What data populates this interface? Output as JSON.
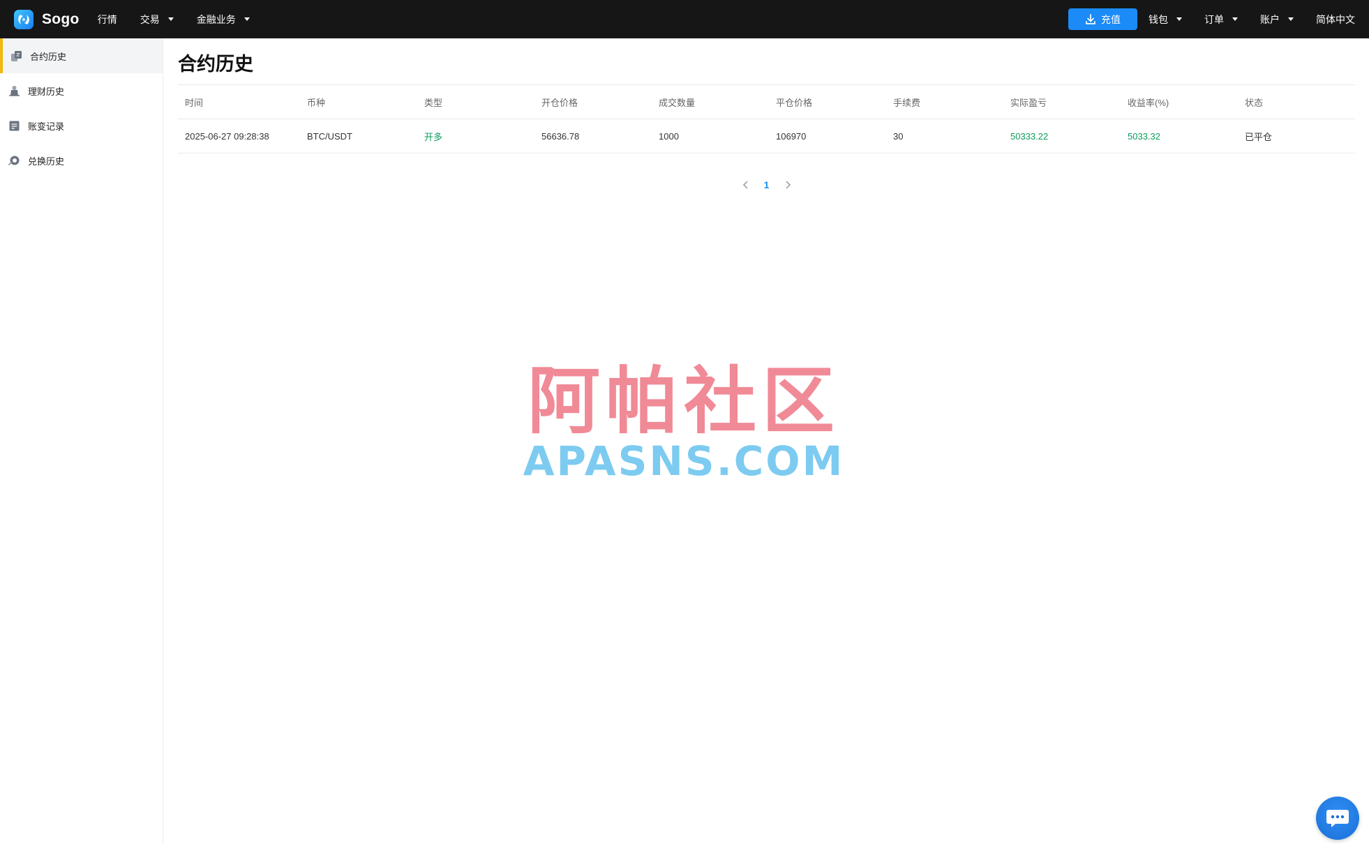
{
  "brand": {
    "name": "Sogo"
  },
  "nav": {
    "left": [
      {
        "label": "行情",
        "dropdown": false
      },
      {
        "label": "交易",
        "dropdown": true
      },
      {
        "label": "金融业务",
        "dropdown": true
      }
    ],
    "recharge_label": "充值",
    "right": [
      {
        "label": "钱包",
        "dropdown": true
      },
      {
        "label": "订单",
        "dropdown": true
      },
      {
        "label": "账户",
        "dropdown": true
      }
    ],
    "language": "简体中文"
  },
  "sidebar": {
    "items": [
      {
        "label": "合约历史",
        "icon": "contract-history-icon",
        "active": true
      },
      {
        "label": "理财历史",
        "icon": "finance-history-icon",
        "active": false
      },
      {
        "label": "账变记录",
        "icon": "account-record-icon",
        "active": false
      },
      {
        "label": "兑换历史",
        "icon": "exchange-history-icon",
        "active": false
      }
    ]
  },
  "page": {
    "title": "合约历史"
  },
  "table": {
    "columns": [
      "时间",
      "币种",
      "类型",
      "开仓价格",
      "成交数量",
      "平仓价格",
      "手续费",
      "实际盈亏",
      "收益率(%)",
      "状态"
    ],
    "rows": [
      [
        "2025-06-27 09:28:38",
        "BTC/USDT",
        "开多",
        "56636.78",
        "1000",
        "106970",
        "30",
        "50333.22",
        "5033.32",
        "已平仓"
      ]
    ]
  },
  "pagination": {
    "current": "1"
  },
  "watermark": {
    "line1": "阿帕社区",
    "line2": "APASNS.COM"
  },
  "colors": {
    "topbar": "#161616",
    "accent_blue": "#1b8bf7",
    "active_marker": "#f0b90b",
    "profit_green": "#0c9b5c"
  }
}
